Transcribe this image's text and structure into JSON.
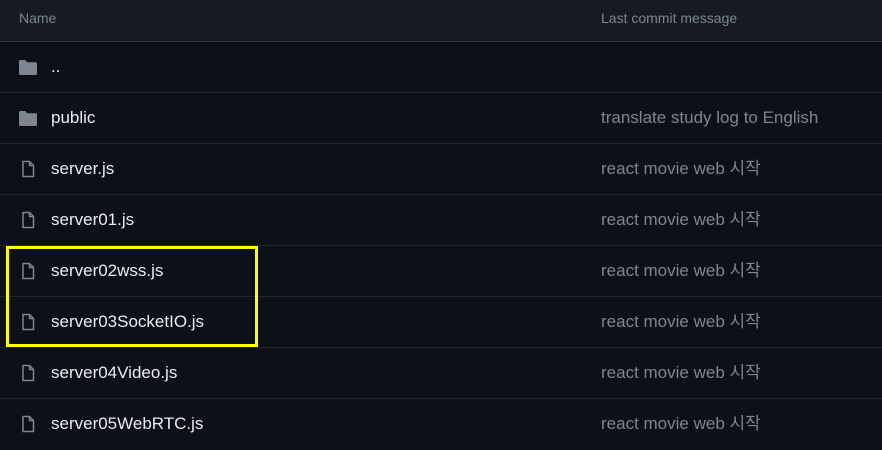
{
  "table": {
    "header": {
      "name": "Name",
      "commit": "Last commit message"
    },
    "rows": [
      {
        "name": "..",
        "commit": "",
        "icon": "folder-icon"
      },
      {
        "name": "public",
        "commit": "translate study log to English",
        "icon": "folder-icon"
      },
      {
        "name": "server.js",
        "commit": "react movie web 시작",
        "icon": "file-icon"
      },
      {
        "name": "server01.js",
        "commit": "react movie web 시작",
        "icon": "file-icon"
      },
      {
        "name": "server02wss.js",
        "commit": "react movie web 시작",
        "icon": "file-icon"
      },
      {
        "name": "server03SocketIO.js",
        "commit": "react movie web 시작",
        "icon": "file-icon"
      },
      {
        "name": "server04Video.js",
        "commit": "react movie web 시작",
        "icon": "file-icon"
      },
      {
        "name": "server05WebRTC.js",
        "commit": "react movie web 시작",
        "icon": "file-icon"
      }
    ]
  },
  "colors": {
    "background": "#0d1117",
    "header_background": "#161b22",
    "text": "#e6edf3",
    "muted_text": "#7d8590",
    "icon": "#7d8590",
    "highlight": "#ffff00"
  }
}
